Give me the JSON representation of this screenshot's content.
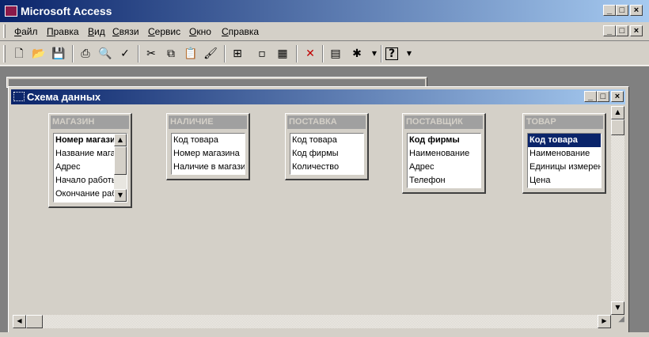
{
  "app": {
    "title": "Microsoft Access"
  },
  "window_controls": {
    "minimize": "_",
    "maximize": "□",
    "close": "×"
  },
  "menu": [
    "Файл",
    "Правка",
    "Вид",
    "Связи",
    "Сервис",
    "Окно",
    "Справка"
  ],
  "toolbar": [
    {
      "name": "new-icon",
      "glyph": "🗋"
    },
    {
      "name": "open-icon",
      "glyph": "📂"
    },
    {
      "name": "save-icon",
      "glyph": "💾"
    },
    {
      "name": "print-icon",
      "glyph": "⎙"
    },
    {
      "name": "print-preview-icon",
      "glyph": "🔍"
    },
    {
      "name": "spelling-icon",
      "glyph": "✓"
    },
    {
      "name": "cut-icon",
      "glyph": "✂"
    },
    {
      "name": "copy-icon",
      "glyph": "⧉"
    },
    {
      "name": "paste-icon",
      "glyph": "📋"
    },
    {
      "name": "format-painter-icon",
      "glyph": "🖌"
    },
    {
      "name": "show-table-icon",
      "glyph": "⊞"
    },
    {
      "name": "show-direct-relationships-icon",
      "glyph": "▫"
    },
    {
      "name": "show-all-relationships-icon",
      "glyph": "▦"
    },
    {
      "name": "delete-icon",
      "glyph": "✕"
    },
    {
      "name": "properties-icon",
      "glyph": "▤"
    },
    {
      "name": "new-object-icon",
      "glyph": "✱"
    },
    {
      "name": "help-icon",
      "glyph": "?"
    }
  ],
  "schema_window": {
    "title": "Схема данных"
  },
  "tables": [
    {
      "name": "МАГАЗИН",
      "fields": [
        "Номер магазина",
        "Название магазина",
        "Адрес",
        "Начало работы",
        "Окончание работы"
      ],
      "bold": [
        0
      ],
      "selected": [],
      "scrollbar": true
    },
    {
      "name": "НАЛИЧИЕ",
      "fields": [
        "Код товара",
        "Номер магазина",
        "Наличие в магазине"
      ],
      "bold": [],
      "selected": [],
      "scrollbar": false
    },
    {
      "name": "ПОСТАВКА",
      "fields": [
        "Код товара",
        "Код фирмы",
        "Количество"
      ],
      "bold": [],
      "selected": [],
      "scrollbar": false
    },
    {
      "name": "ПОСТАВЩИК",
      "fields": [
        "Код фирмы",
        "Наименование",
        "Адрес",
        "Телефон"
      ],
      "bold": [
        0
      ],
      "selected": [],
      "scrollbar": false
    },
    {
      "name": "ТОВАР",
      "fields": [
        "Код товара",
        "Наименование",
        "Единицы измерения",
        "Цена"
      ],
      "bold": [
        0
      ],
      "selected": [
        0
      ],
      "scrollbar": false
    }
  ]
}
